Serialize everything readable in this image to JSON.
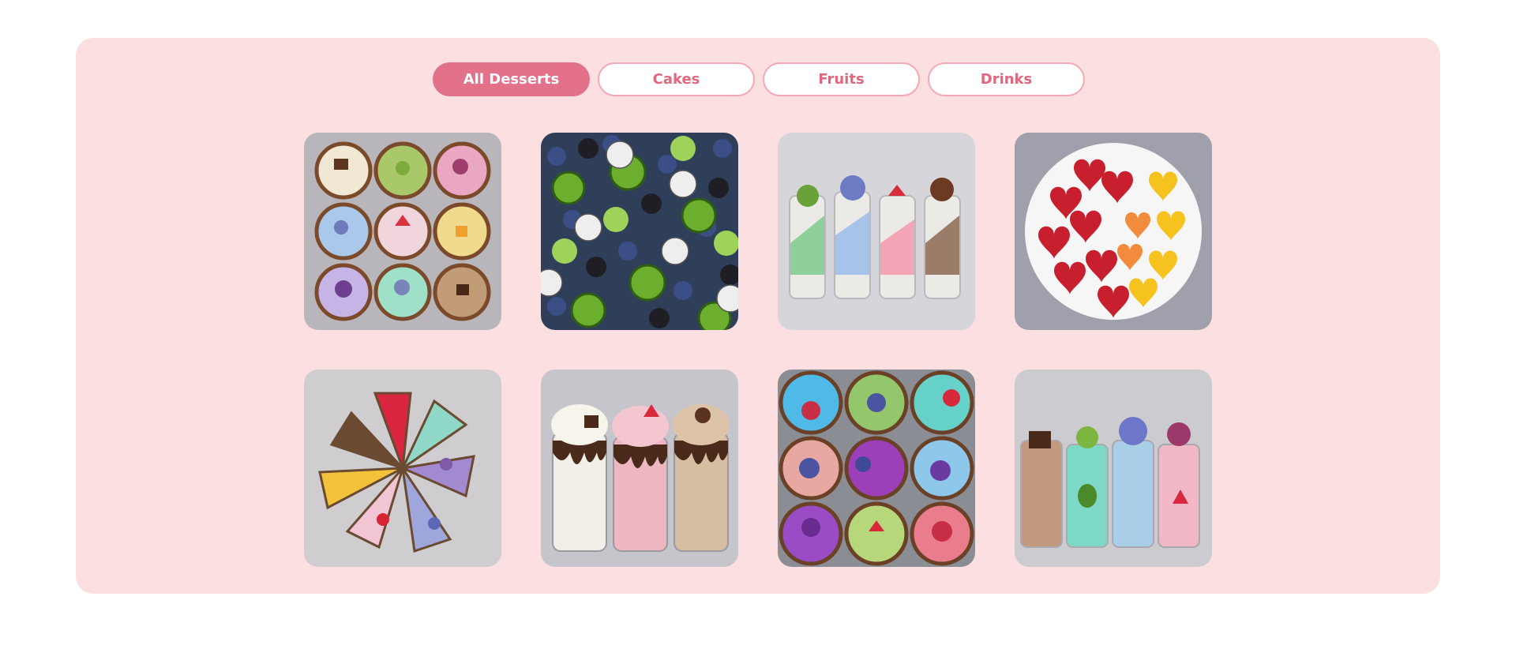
{
  "filters": [
    {
      "label": "All Desserts",
      "active": true
    },
    {
      "label": "Cakes",
      "active": false
    },
    {
      "label": "Fruits",
      "active": false
    },
    {
      "label": "Drinks",
      "active": false
    }
  ],
  "gallery": [
    {
      "subject": "nine-smoothie-bowls-toppings"
    },
    {
      "subject": "kiwi-blueberry-dragonfruit-mix"
    },
    {
      "subject": "layered-parfait-glasses"
    },
    {
      "subject": "heart-shaped-fruit-plate"
    },
    {
      "subject": "cheesecake-slices-wheel"
    },
    {
      "subject": "whipped-cream-milkshakes"
    },
    {
      "subject": "acai-smoothie-bowls"
    },
    {
      "subject": "pastel-smoothie-glasses"
    }
  ],
  "colors": {
    "panel": "#fcdfe0",
    "accent": "#e3718a",
    "button_text": "#e0677e",
    "button_border": "#f4a9b6"
  }
}
